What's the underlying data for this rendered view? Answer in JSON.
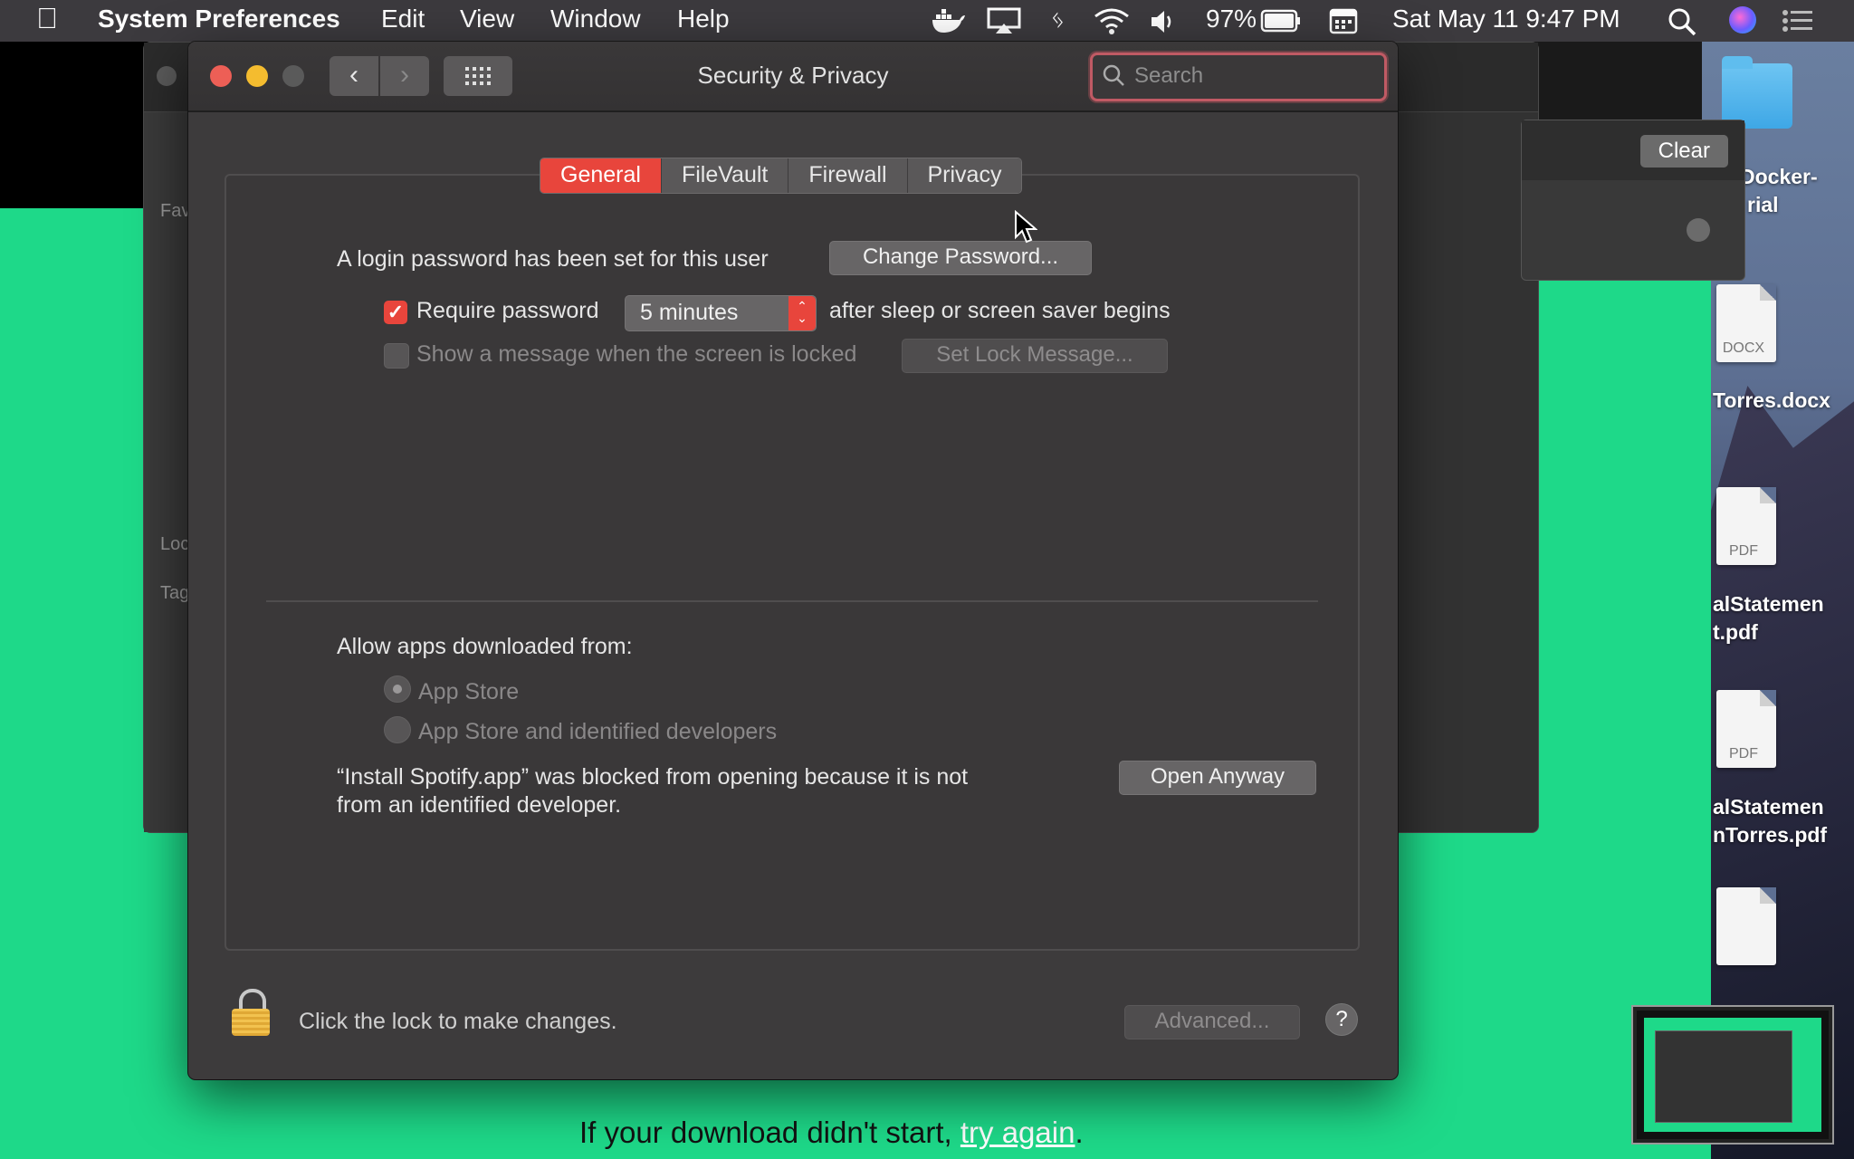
{
  "menubar": {
    "app_name": "System Preferences",
    "menus": [
      "Edit",
      "View",
      "Window",
      "Help"
    ],
    "battery_percent": "97%",
    "clock": "Sat May 11  9:47 PM",
    "icons": [
      "apple-icon",
      "docker-icon",
      "airplay-icon",
      "bluetooth-icon",
      "wifi-icon",
      "volume-icon",
      "battery-icon",
      "calendar-icon",
      "spotlight-icon",
      "siri-icon",
      "notification-center-icon"
    ]
  },
  "window": {
    "title": "Security & Privacy",
    "search_placeholder": "Search"
  },
  "tabs": [
    {
      "label": "General",
      "active": true
    },
    {
      "label": "FileVault",
      "active": false
    },
    {
      "label": "Firewall",
      "active": false
    },
    {
      "label": "Privacy",
      "active": false
    }
  ],
  "general": {
    "login_password_text": "A login password has been set for this user",
    "change_password_button": "Change Password...",
    "require_password_label": "Require password",
    "require_password_checked": true,
    "require_password_delay": "5 minutes",
    "after_sleep_text": "after sleep or screen saver begins",
    "show_message_label": "Show a message when the screen is locked",
    "show_message_checked": false,
    "set_lock_message_button": "Set Lock Message..."
  },
  "allow_apps": {
    "heading": "Allow apps downloaded from:",
    "options": [
      "App Store",
      "App Store and identified developers"
    ],
    "selected": "App Store",
    "blocked_message_line1": "“Install Spotify.app” was blocked from opening because it is not",
    "blocked_message_line2": "from an identified developer.",
    "open_anyway_button": "Open Anyway"
  },
  "footer": {
    "lock_text": "Click the lock to make changes.",
    "advanced_button": "Advanced...",
    "help_button": "?"
  },
  "background": {
    "download_text": "If your download didn't start,",
    "try_again_link": "try again",
    "download_suffix": ".",
    "clear_button": "Clear",
    "back_window_sidebar": [
      "Fav",
      "Loc",
      "Tag"
    ]
  },
  "desktop": {
    "labels": [
      "Docker-",
      "rial",
      "Torres.docx",
      "alStatemen",
      "t.pdf",
      "alStatemen",
      "nTorres.pdf"
    ],
    "doc_tags": [
      "DOCX",
      "PDF",
      "PDF"
    ]
  },
  "colors": {
    "accent": "#e8453c",
    "spotify_green": "#1ed989",
    "window_bg": "#3d3b3c",
    "menubar_bg": "#3c3a3e"
  }
}
